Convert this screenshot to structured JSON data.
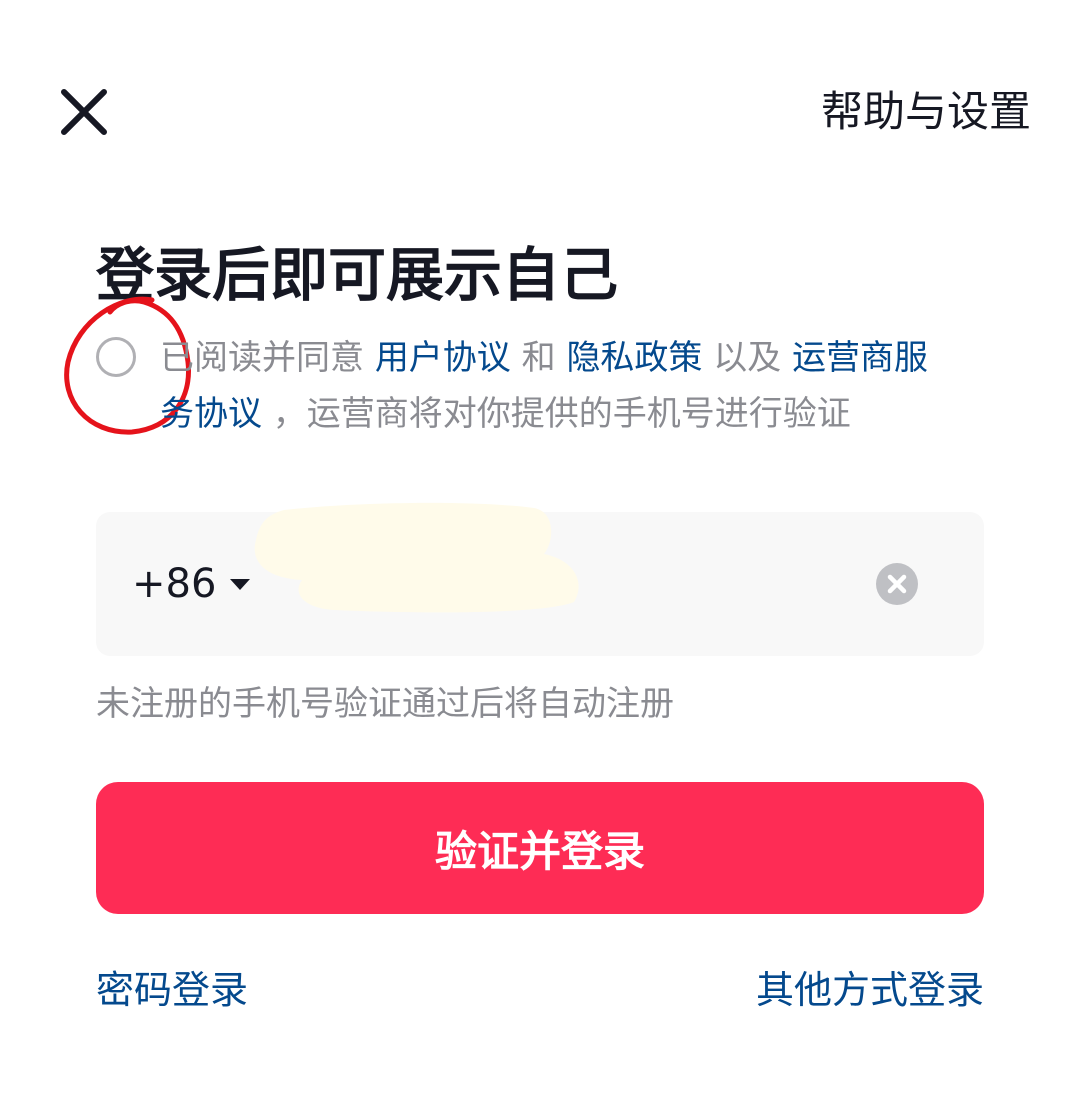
{
  "header": {
    "close_icon": "close-icon",
    "help_label": "帮助与设置"
  },
  "title": "登录后即可展示自己",
  "agreement": {
    "checked": false,
    "prefix": "已阅读并同意 ",
    "user_agreement": "用户协议",
    "and": " 和 ",
    "privacy_policy": "隐私政策",
    "and_also": " 以及 ",
    "carrier_agreement": "运营商服务协议",
    "suffix": " ，运营商将对你提供的手机号进行验证"
  },
  "phone": {
    "country_code": "+86",
    "value": "",
    "clear_icon": "clear-icon"
  },
  "hint": "未注册的手机号验证通过后将自动注册",
  "login_button": "验证并登录",
  "footer": {
    "password_login": "密码登录",
    "other_login": "其他方式登录"
  },
  "colors": {
    "accent": "#fe2c55",
    "link": "#04498d",
    "annotation": "#e5131b",
    "redaction": "#fffbea"
  }
}
